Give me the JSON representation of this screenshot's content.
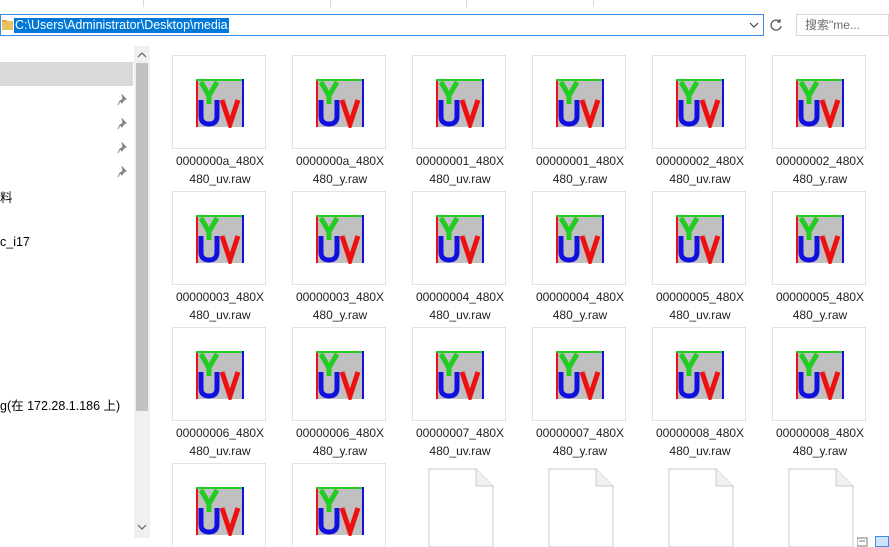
{
  "address": {
    "path": "C:\\Users\\Administrator\\Desktop\\media"
  },
  "search": {
    "text": "搜索\"me..."
  },
  "nav": {
    "items": [
      {
        "label": "料"
      },
      {
        "label": "c_i17"
      },
      {
        "label": "g(在 172.28.1.186 上)"
      }
    ]
  },
  "files": [
    {
      "line1": "0000000a_480X",
      "line2": "480_uv.raw"
    },
    {
      "line1": "0000000a_480X",
      "line2": "480_y.raw"
    },
    {
      "line1": "00000001_480X",
      "line2": "480_uv.raw"
    },
    {
      "line1": "00000001_480X",
      "line2": "480_y.raw"
    },
    {
      "line1": "00000002_480X",
      "line2": "480_uv.raw"
    },
    {
      "line1": "00000002_480X",
      "line2": "480_y.raw"
    },
    {
      "line1": "00000003_480X",
      "line2": "480_uv.raw"
    },
    {
      "line1": "00000003_480X",
      "line2": "480_y.raw"
    },
    {
      "line1": "00000004_480X",
      "line2": "480_uv.raw"
    },
    {
      "line1": "00000004_480X",
      "line2": "480_y.raw"
    },
    {
      "line1": "00000005_480X",
      "line2": "480_uv.raw"
    },
    {
      "line1": "00000005_480X",
      "line2": "480_y.raw"
    },
    {
      "line1": "00000006_480X",
      "line2": "480_uv.raw"
    },
    {
      "line1": "00000006_480X",
      "line2": "480_y.raw"
    },
    {
      "line1": "00000007_480X",
      "line2": "480_uv.raw"
    },
    {
      "line1": "00000007_480X",
      "line2": "480_y.raw"
    },
    {
      "line1": "00000008_480X",
      "line2": "480_uv.raw"
    },
    {
      "line1": "00000008_480X",
      "line2": "480_y.raw"
    }
  ],
  "icons": {
    "yuv_file": "yuv-viewer-icon",
    "blank_file": "blank-document-icon"
  },
  "colors": {
    "selection": "#0078d7",
    "nav_selected": "#d9d9d9",
    "yuv_y": "#22cc22",
    "yuv_u": "#1010e0",
    "yuv_v": "#ee1111"
  }
}
